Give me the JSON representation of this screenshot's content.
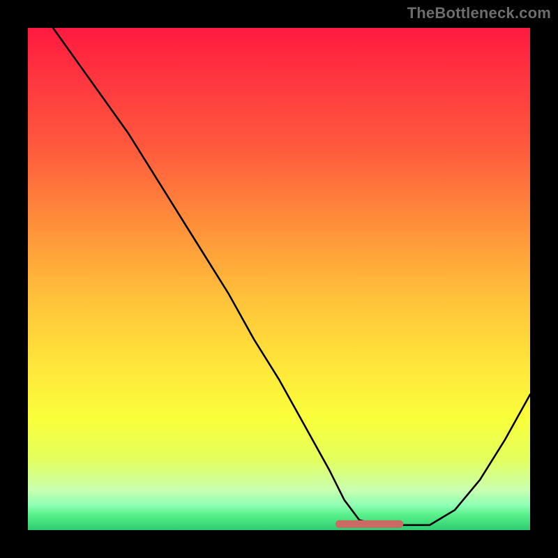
{
  "watermark": "TheBottleneck.com",
  "colors": {
    "frame": "#000000",
    "curve": "#000000",
    "marker": "#c96a63",
    "gradient_stops": [
      "#ff1a40",
      "#ff3b3f",
      "#ff5a3d",
      "#ff923a",
      "#ffc23a",
      "#ffe53a",
      "#f9ff3b",
      "#e3ff5e",
      "#c9ffb0",
      "#8fffb5",
      "#58f08a",
      "#2ecc71"
    ]
  },
  "chart_data": {
    "type": "line",
    "title": "",
    "xlabel": "",
    "ylabel": "",
    "xlim": [
      0,
      100
    ],
    "ylim": [
      0,
      100
    ],
    "grid": false,
    "series": [
      {
        "name": "bottleneck-curve",
        "x": [
          5,
          10,
          15,
          20,
          25,
          30,
          35,
          40,
          45,
          50,
          55,
          60,
          63,
          66,
          70,
          75,
          80,
          85,
          90,
          95,
          100
        ],
        "y": [
          100,
          93,
          86,
          79,
          71,
          63,
          55,
          47,
          38,
          30,
          21,
          12,
          6,
          2,
          1,
          1,
          1,
          4,
          10,
          18,
          27
        ]
      }
    ],
    "annotations": [
      {
        "name": "trough-marker",
        "shape": "thick-segment",
        "x_start": 62,
        "x_end": 74,
        "y": 1.2,
        "color": "#c96a63"
      }
    ]
  }
}
